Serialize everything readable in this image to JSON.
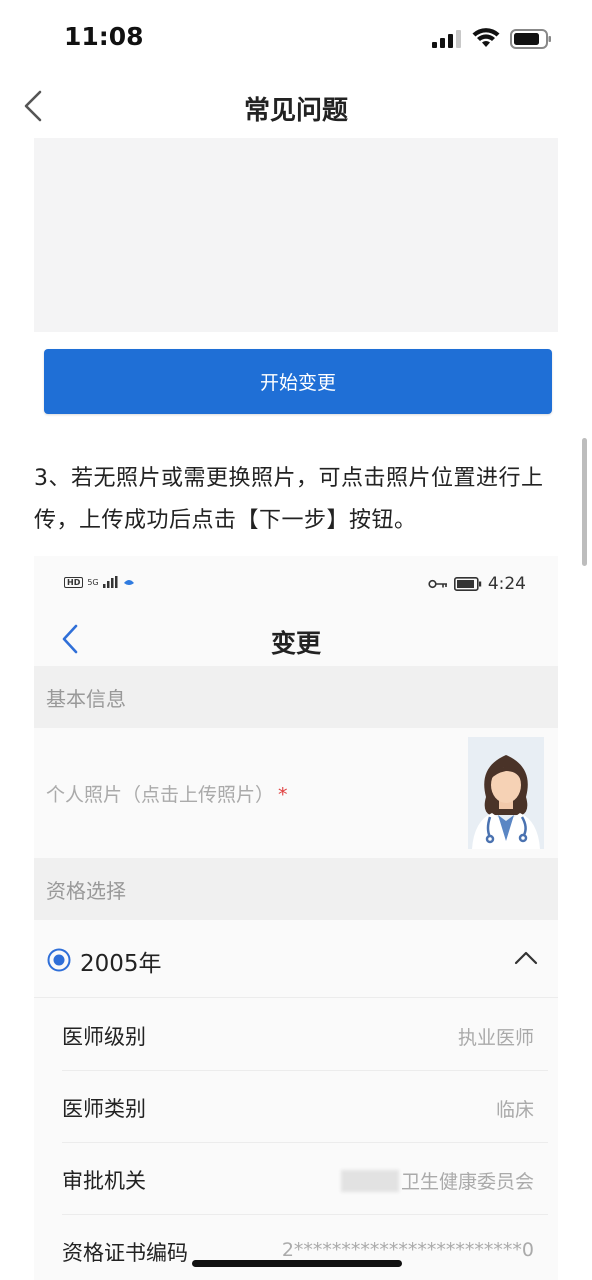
{
  "status_bar": {
    "time": "11:08"
  },
  "nav": {
    "title": "常见问题"
  },
  "start_button_label": "开始变更",
  "step_text": "3、若无照片或需更换照片，可点击照片位置进行上传，上传成功后点击【下一步】按钮。",
  "inner": {
    "status_time": "4:24",
    "status_left": "5G",
    "hd": "HD",
    "nav_title": "变更",
    "basic_info_header": "基本信息",
    "photo_label": "个人照片（点击上传照片）",
    "required_mark": "*",
    "qualification_header": "资格选择",
    "year": "2005年",
    "rows": [
      {
        "label": "医师级别",
        "value": "执业医师"
      },
      {
        "label": "医师类别",
        "value": "临床"
      },
      {
        "label": "审批机关",
        "value": "卫生健康委员会"
      },
      {
        "label": "资格证书编码",
        "value": "2************************0"
      }
    ]
  },
  "colors": {
    "accent": "#1f6fd6",
    "required": "#e04040"
  }
}
